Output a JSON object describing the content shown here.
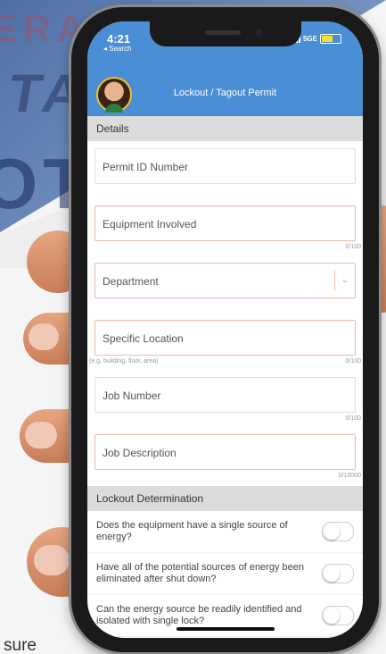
{
  "background": {
    "words": [
      "ERATE",
      "TA",
      "OT"
    ],
    "caption": "sure"
  },
  "status_bar": {
    "time": "4:21",
    "back_label": "◂ Search",
    "network": "5GE"
  },
  "header": {
    "title": "Lockout / Tagout Permit"
  },
  "sections": {
    "details": "Details",
    "lockout_determination": "Lockout Determination"
  },
  "fields": {
    "permit_id": {
      "placeholder": "Permit ID Number"
    },
    "equipment": {
      "placeholder": "Equipment Involved",
      "counter": "0/100"
    },
    "department": {
      "placeholder": "Department"
    },
    "location": {
      "placeholder": "Specific Location",
      "hint": "(e.g. building, floor, area)",
      "counter": "0/100"
    },
    "job_number": {
      "placeholder": "Job Number",
      "counter": "0/100"
    },
    "job_description": {
      "placeholder": "Job Description",
      "counter": "0/10000"
    }
  },
  "questions": [
    {
      "text": "Does the equipment have a single source of energy?"
    },
    {
      "text": "Have all of the potential sources of energy been eliminated after shut down?"
    },
    {
      "text": "Can the energy source be readily identified and isolated with single lock?"
    }
  ],
  "colors": {
    "header": "#4a8fd6",
    "field_border": "#f0b9a8",
    "section_bar": "#dcdcdc"
  }
}
